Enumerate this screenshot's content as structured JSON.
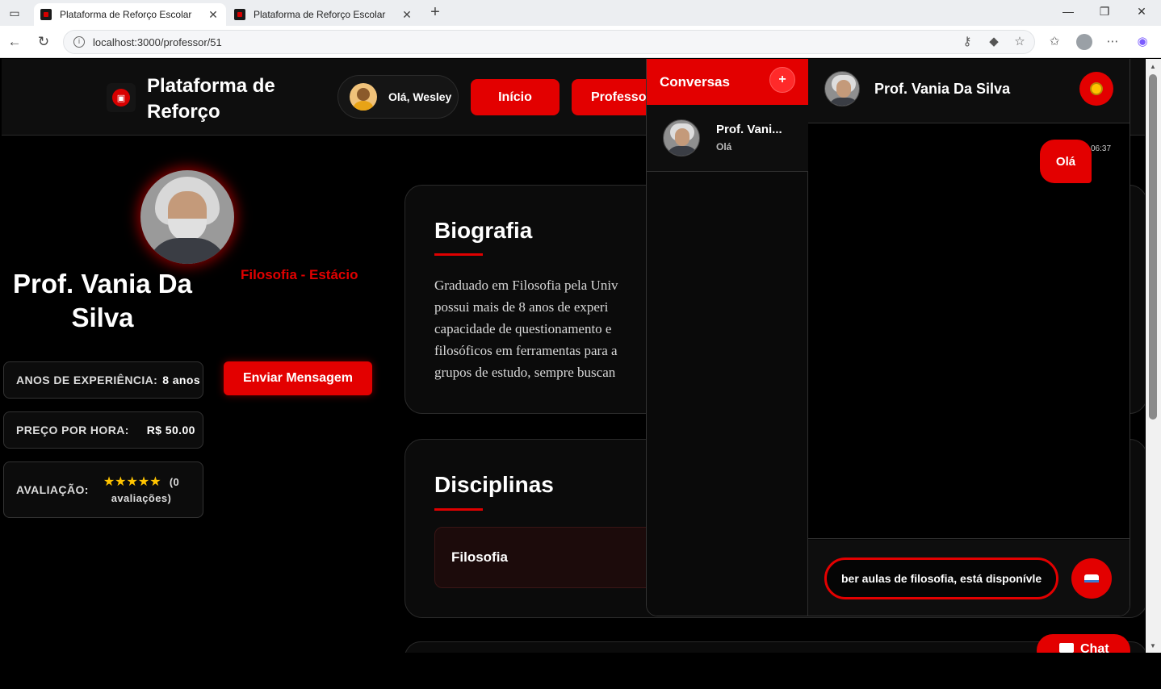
{
  "browser": {
    "tabs": [
      {
        "title": "Plataforma de Reforço Escolar",
        "active": true
      },
      {
        "title": "Plataforma de Reforço Escolar",
        "active": false
      }
    ],
    "url": "localhost:3000/professor/51"
  },
  "header": {
    "logo_text": "Plataforma de Reforço",
    "greeting": "Olá, Wesley",
    "nav": [
      "Início",
      "Professor"
    ]
  },
  "profile": {
    "name": "Prof. Vania Da Silva",
    "subject_tag": "Filosofia - Estácio",
    "experience_label": "ANOS DE EXPERIÊNCIA:",
    "experience_value": "8 anos",
    "price_label": "PREÇO POR HORA:",
    "price_value": "R$ 50.00",
    "rating_label": "AVALIAÇÃO:",
    "rating_stars": "★★★★★",
    "rating_count_open": "(0",
    "rating_count_close": "avaliações)",
    "send_message": "Enviar Mensagem"
  },
  "biography": {
    "title": "Biografia",
    "lines": [
      "Graduado em Filosofia pela Univ",
      "possui mais de 8 anos de experi",
      "capacidade de questionamento e",
      "filosóficos em ferramentas para a",
      "grupos de estudo, sempre buscan"
    ]
  },
  "disciplines": {
    "title": "Disciplinas",
    "items": [
      "Filosofia"
    ]
  },
  "chat_fab": "Chat",
  "chat": {
    "conversations_title": "Conversas",
    "add_label": "+",
    "conversations": [
      {
        "name": "Prof. Vani...",
        "preview": "Olá"
      }
    ],
    "thread_name": "Prof. Vania Da Silva",
    "messages": [
      {
        "text": "Olá",
        "time": "06:37",
        "mine": true
      }
    ],
    "input_value": "ber aulas de filosofia, está disponívle"
  },
  "colors": {
    "accent": "#e30000",
    "background": "#000000",
    "star": "#ffc400"
  }
}
